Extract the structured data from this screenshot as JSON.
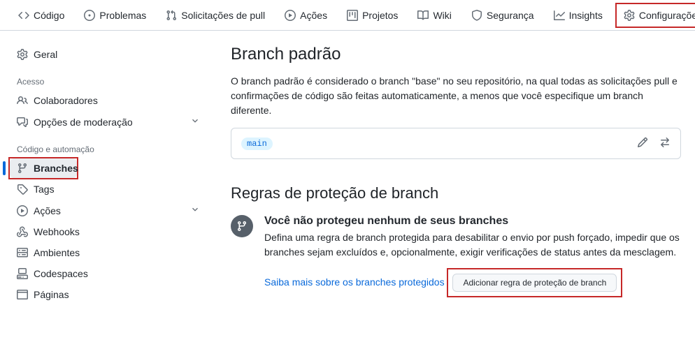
{
  "topnav": {
    "code": "Código",
    "issues": "Problemas",
    "pulls": "Solicitações de pull",
    "actions": "Ações",
    "projects": "Projetos",
    "wiki": "Wiki",
    "security": "Segurança",
    "insights": "Insights",
    "settings": "Configurações"
  },
  "sidebar": {
    "general": "Geral",
    "section_access": "Acesso",
    "collaborators": "Colaboradores",
    "moderation": "Opções de moderação",
    "section_code": "Código e automação",
    "branches": "Branches",
    "tags": "Tags",
    "actions": "Ações",
    "webhooks": "Webhooks",
    "environments": "Ambientes",
    "codespaces": "Codespaces",
    "pages": "Páginas"
  },
  "main": {
    "default_branch_heading": "Branch padrão",
    "default_branch_desc": "O branch padrão é considerado o branch \"base\" no seu repositório, na qual todas as solicitações pull e confirmações de código são feitas automaticamente, a menos que você especifique um branch diferente.",
    "branch_name": "main",
    "protection_heading": "Regras de proteção de branch",
    "protect_title": "Você não protegeu nenhum de seus branches",
    "protect_desc": "Defina uma regra de branch protegida para desabilitar o envio por push forçado, impedir que os branches sejam excluídos e, opcionalmente, exigir verificações de status antes da mesclagem.",
    "protect_link": "Saiba mais sobre os branches protegidos",
    "add_rule_btn": "Adicionar regra de proteção de branch"
  }
}
